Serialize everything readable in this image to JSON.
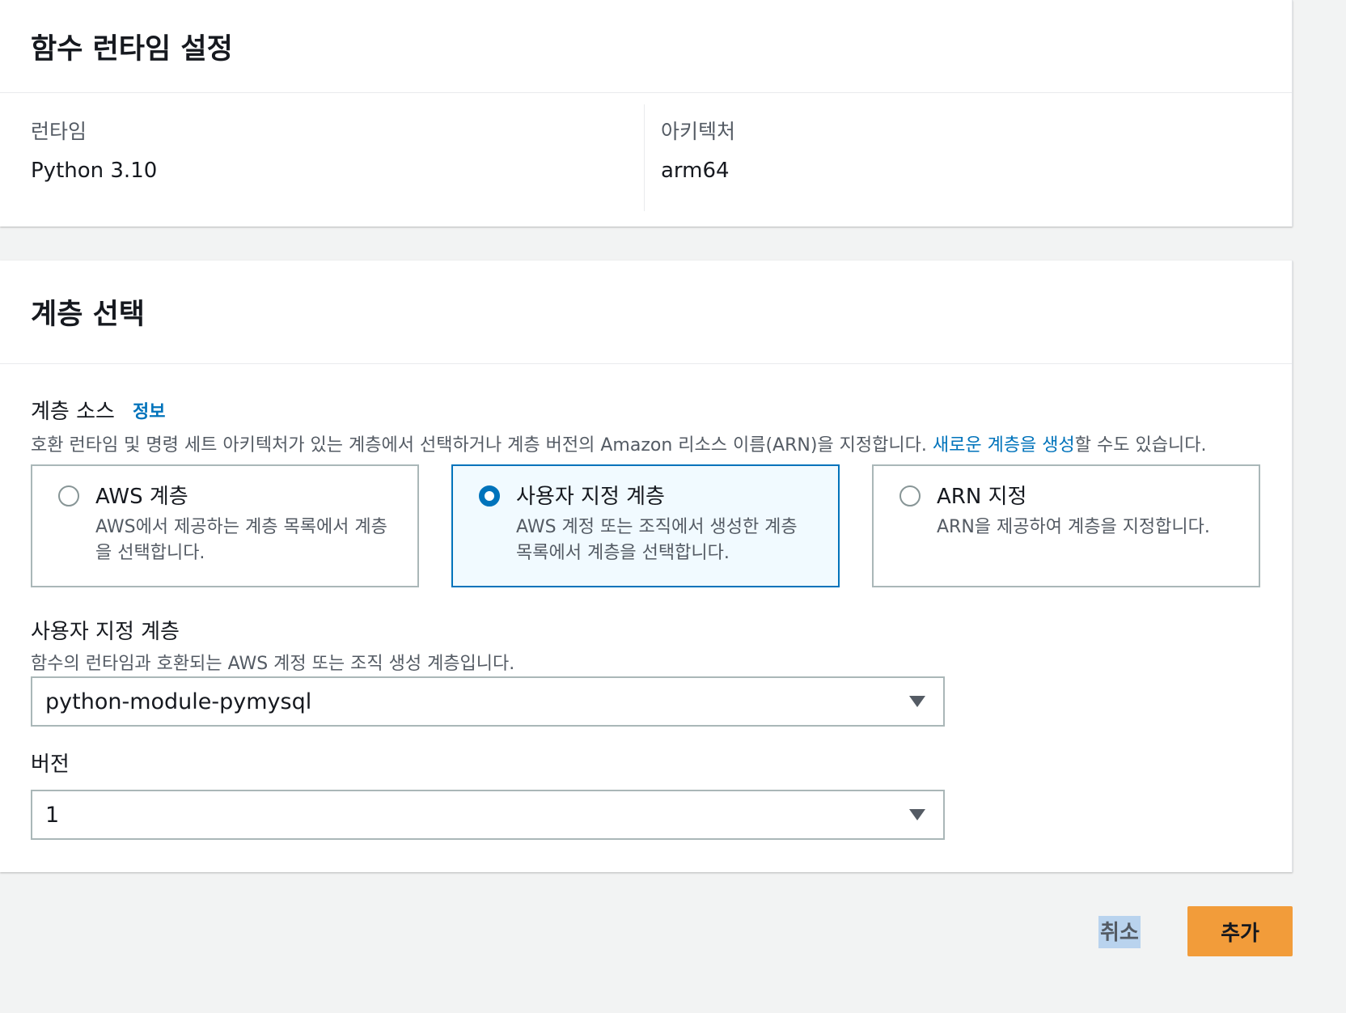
{
  "runtime_panel": {
    "title": "함수 런타임 설정",
    "runtime_label": "런타임",
    "runtime_value": "Python 3.10",
    "architecture_label": "아키텍처",
    "architecture_value": "arm64"
  },
  "layers_panel": {
    "title": "계층 선택",
    "source_label": "계층 소스",
    "info_link": "정보",
    "source_desc_prefix": "호환 런타임 및 명령 세트 아키텍처가 있는 계층에서 선택하거나 계층 버전의 Amazon 리소스 이름(ARN)을 지정합니다. ",
    "source_desc_link": "새로운 계층을 생성",
    "source_desc_suffix": "할 수도 있습니다.",
    "tiles": [
      {
        "title": "AWS 계층",
        "desc": "AWS에서 제공하는 계층 목록에서 계층을 선택합니다.",
        "selected": false
      },
      {
        "title": "사용자 지정 계층",
        "desc": "AWS 계정 또는 조직에서 생성한 계층 목록에서 계층을 선택합니다.",
        "selected": true
      },
      {
        "title": "ARN 지정",
        "desc": "ARN을 제공하여 계층을 지정합니다.",
        "selected": false
      }
    ],
    "custom_layer_label": "사용자 지정 계층",
    "custom_layer_desc": "함수의 런타임과 호환되는 AWS 계정 또는 조직 생성 계층입니다.",
    "custom_layer_value": "python-module-pymysql",
    "version_label": "버전",
    "version_value": "1"
  },
  "footer": {
    "cancel_label": "취소",
    "add_label": "추가"
  },
  "colors": {
    "accent": "#0073bb",
    "primary_button": "#f29c3a",
    "selected_tile_bg": "#f1faff"
  }
}
